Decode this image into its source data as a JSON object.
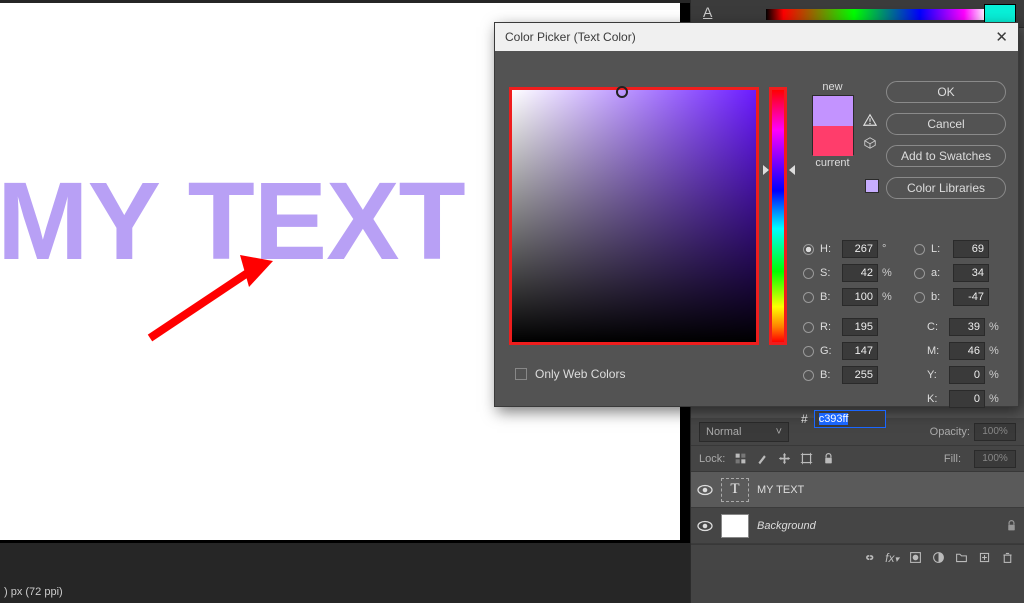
{
  "canvas_text": "MY TEXT",
  "status_bar": ") px (72 ppi)",
  "panel_letter": "A",
  "dialog": {
    "title": "Color Picker (Text Color)",
    "close": "✕",
    "new_label": "new",
    "current_label": "current",
    "buttons": {
      "ok": "OK",
      "cancel": "Cancel",
      "swatches": "Add to Swatches",
      "libraries": "Color Libraries"
    },
    "web_only": "Only Web Colors",
    "hsb": {
      "H": "267",
      "H_unit": "°",
      "S": "42",
      "S_unit": "%",
      "B": "100",
      "B_unit": "%"
    },
    "lab": {
      "L": "69",
      "a": "34",
      "b": "-47"
    },
    "rgb": {
      "R": "195",
      "G": "147",
      "B": "255"
    },
    "cmyk": {
      "C": "39",
      "M": "46",
      "Y": "0",
      "K": "0"
    },
    "pct": "%",
    "hex": "c393ff"
  },
  "layers": {
    "blend": "Normal",
    "opacity_label": "Opacity:",
    "opacity_value": "100%",
    "lock_label": "Lock:",
    "fill_label": "Fill:",
    "fill_value": "100%",
    "layer1": "MY TEXT",
    "layer2": "Background"
  }
}
